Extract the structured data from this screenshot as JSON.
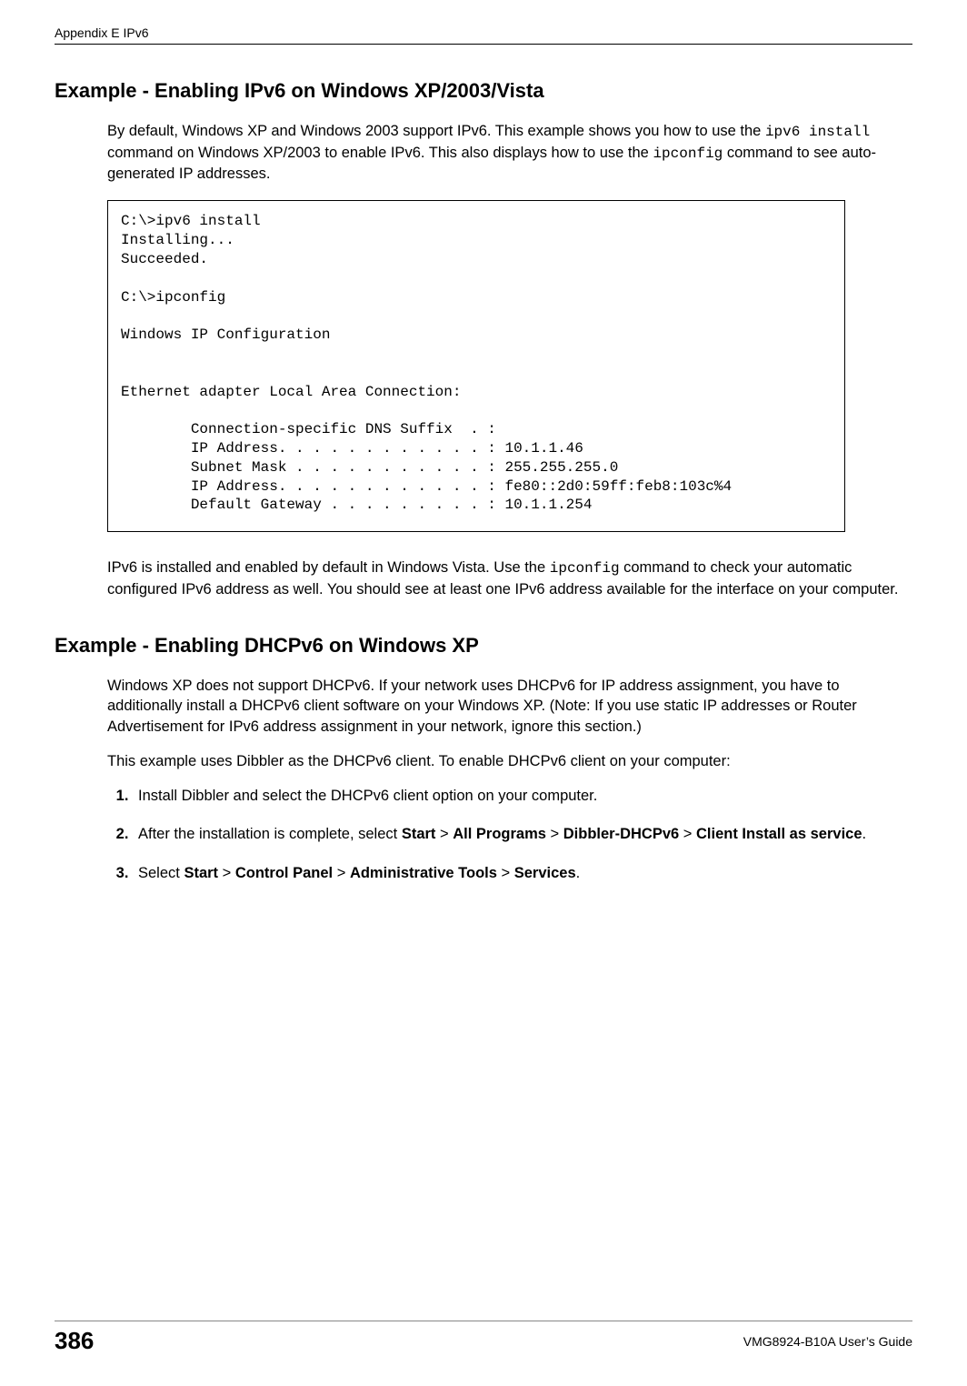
{
  "header": {
    "left": "Appendix E IPv6"
  },
  "sections": {
    "ex1": {
      "title": "Example - Enabling IPv6 on Windows XP/2003/Vista",
      "para1_pre": "By default, Windows XP and Windows 2003 support IPv6. This example shows you how to use the ",
      "para1_cmd1": "ipv6 install",
      "para1_mid": " command on Windows XP/2003 to enable IPv6. This also displays how to use the ",
      "para1_cmd2": "ipconfig",
      "para1_post": " command to see auto-generated IP addresses.",
      "code": "C:\\>ipv6 install\nInstalling...\nSucceeded.\n\nC:\\>ipconfig\n\nWindows IP Configuration\n\n\nEthernet adapter Local Area Connection:\n\n        Connection-specific DNS Suffix  . :\n        IP Address. . . . . . . . . . . . : 10.1.1.46\n        Subnet Mask . . . . . . . . . . . : 255.255.255.0\n        IP Address. . . . . . . . . . . . : fe80::2d0:59ff:feb8:103c%4\n        Default Gateway . . . . . . . . . : 10.1.1.254",
      "para2_pre": "IPv6 is installed and enabled by default in Windows Vista. Use the ",
      "para2_cmd": "ipconfig",
      "para2_post": " command to check your automatic configured IPv6 address as well. You should see at least one IPv6 address available for the interface on your computer."
    },
    "ex2": {
      "title": "Example - Enabling DHCPv6 on Windows XP",
      "para1": "Windows XP does not support DHCPv6. If your network uses DHCPv6 for IP address assignment, you have to additionally install a DHCPv6 client software on your Windows XP. (Note: If you use static IP addresses or Router Advertisement for IPv6 address assignment in your network, ignore this section.)",
      "para2": "This example uses Dibbler as the DHCPv6 client. To enable DHCPv6 client on your computer:",
      "steps": {
        "s1": "Install Dibbler and select the DHCPv6 client option on your computer.",
        "s2_pre": "After the installation is complete, select ",
        "s2_b1": "Start",
        "s2_gt1": " > ",
        "s2_b2": "All Programs",
        "s2_gt2": " > ",
        "s2_b3": "Dibbler-DHCPv6",
        "s2_gt3": " > ",
        "s2_b4": "Client Install as service",
        "s2_post": ".",
        "s3_pre": "Select ",
        "s3_b1": "Start",
        "s3_gt1": " > ",
        "s3_b2": "Control Panel",
        "s3_gt2": " > ",
        "s3_b3": "Administrative Tools",
        "s3_gt3": " > ",
        "s3_b4": "Services",
        "s3_post": "."
      }
    }
  },
  "footer": {
    "page": "386",
    "guide": "VMG8924-B10A User’s Guide"
  }
}
